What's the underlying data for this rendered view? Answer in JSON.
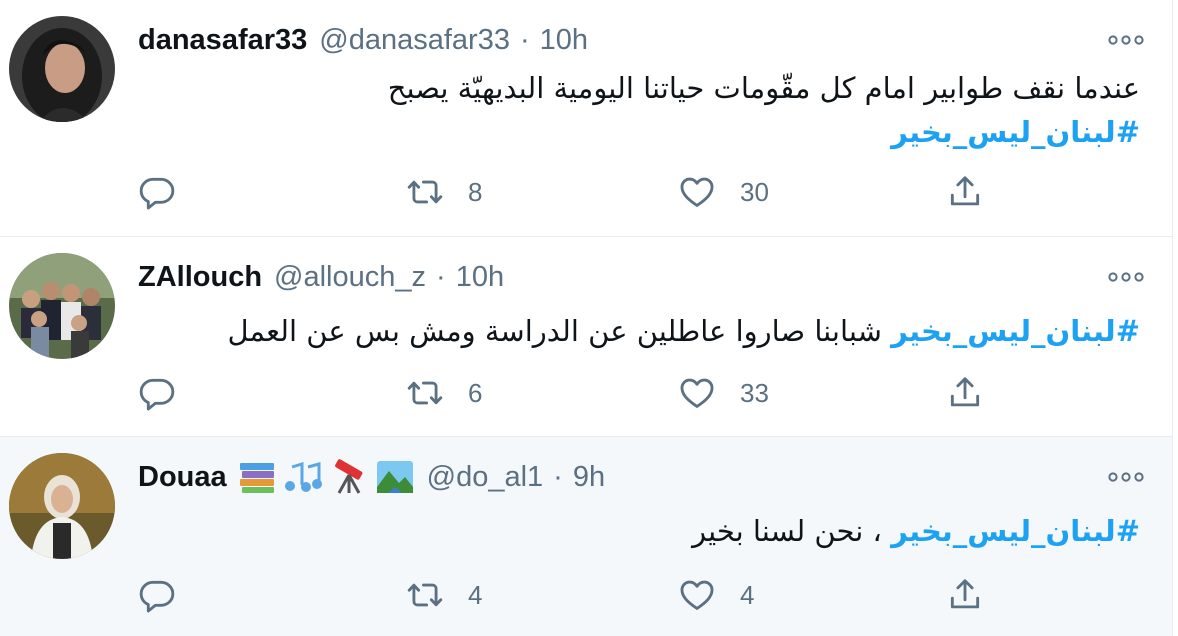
{
  "colors": {
    "accent": "#1da1f2",
    "muted": "#5b7083",
    "text": "#0f1419",
    "hover_bg": "#f5f8fa"
  },
  "tweets": [
    {
      "name": "danasafar33",
      "handle": "@danasafar33",
      "separator": "·",
      "time": "10h",
      "text_before": "عندما نقف طوابير امام كل مقّومات حياتنا اليومية البديهيّة يصبح",
      "hashtag": "#لبنان_ليس_بخير",
      "text_after": "",
      "retweets": "8",
      "likes": "30",
      "icons": [
        "reply-icon",
        "retweet-icon",
        "like-icon",
        "share-icon",
        "more-icon"
      ]
    },
    {
      "name": "ZAllouch",
      "handle": "@allouch_z",
      "separator": "·",
      "time": "10h",
      "text_before": "",
      "hashtag": "#لبنان_ليس_بخير",
      "text_after": "شبابنا صاروا عاطلين عن الدراسة ومش بس عن العمل",
      "retweets": "6",
      "likes": "33",
      "icons": [
        "reply-icon",
        "retweet-icon",
        "like-icon",
        "share-icon",
        "more-icon"
      ]
    },
    {
      "name": "Douaa",
      "name_emojis": [
        "books-emoji",
        "musical-notes-emoji",
        "telescope-emoji",
        "national-park-emoji"
      ],
      "handle": "@do_al1",
      "separator": "·",
      "time": "9h",
      "text_before": "",
      "hashtag": "#لبنان_ليس_بخير",
      "text_after": "، نحن لسنا بخير",
      "retweets": "4",
      "likes": "4",
      "icons": [
        "reply-icon",
        "retweet-icon",
        "like-icon",
        "share-icon",
        "more-icon"
      ]
    }
  ]
}
